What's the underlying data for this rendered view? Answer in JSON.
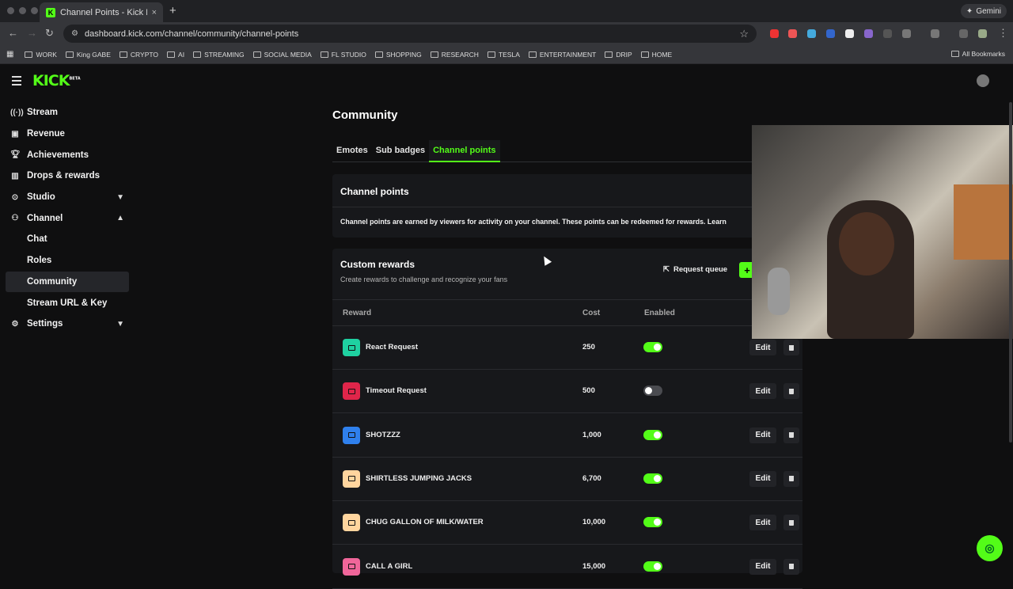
{
  "browser": {
    "tab_title": "Channel Points - Kick Dashbo",
    "tab_close": "×",
    "new_tab": "+",
    "url": "dashboard.kick.com/channel/community/channel-points",
    "gemini_label": "Gemini",
    "bookmarks": [
      "WORK",
      "King GABE",
      "CRYPTO",
      "AI",
      "STREAMING",
      "SOCIAL MEDIA",
      "FL STUDIO",
      "SHOPPING",
      "RESEARCH",
      "TESLA",
      "ENTERTAINMENT",
      "DRIP",
      "HOME"
    ],
    "all_bookmarks": "All Bookmarks"
  },
  "brand": {
    "logo": "KICK",
    "badge": "BETA",
    "accent": "#53fc18"
  },
  "sidebar": {
    "items": [
      {
        "label": "Stream",
        "icon": "broadcast-icon"
      },
      {
        "label": "Revenue",
        "icon": "wallet-icon"
      },
      {
        "label": "Achievements",
        "icon": "trophy-icon"
      },
      {
        "label": "Drops & rewards",
        "icon": "gift-icon"
      },
      {
        "label": "Studio",
        "icon": "studio-icon"
      },
      {
        "label": "Channel",
        "icon": "users-icon"
      },
      {
        "label": "Chat"
      },
      {
        "label": "Roles"
      },
      {
        "label": "Community"
      },
      {
        "label": "Stream URL & Key"
      },
      {
        "label": "Settings",
        "icon": "gear-icon"
      }
    ]
  },
  "main": {
    "title": "Community",
    "tabs": [
      "Emotes",
      "Sub badges",
      "Channel points"
    ],
    "channel_points": {
      "heading": "Channel points",
      "description": "Channel points are earned by viewers for activity on your channel. These points can be redeemed for rewards. Learn"
    },
    "custom_rewards": {
      "heading": "Custom rewards",
      "subtitle": "Create rewards to challenge and recognize your fans",
      "request_queue": "Request queue",
      "add": "+",
      "columns": {
        "reward": "Reward",
        "cost": "Cost",
        "enabled": "Enabled"
      },
      "edit_label": "Edit",
      "rows": [
        {
          "name": "React Request",
          "cost": "250",
          "enabled": true,
          "color": "#1fd1a1"
        },
        {
          "name": "Timeout Request",
          "cost": "500",
          "enabled": false,
          "color": "#e0254a"
        },
        {
          "name": "SHOTZZZ",
          "cost": "1,000",
          "enabled": true,
          "color": "#2f80ed"
        },
        {
          "name": "SHIRTLESS JUMPING JACKS",
          "cost": "6,700",
          "enabled": true,
          "color": "#ffd59e"
        },
        {
          "name": "CHUG GALLON OF MILK/WATER",
          "cost": "10,000",
          "enabled": true,
          "color": "#ffd59e"
        },
        {
          "name": "CALL A GIRL",
          "cost": "15,000",
          "enabled": true,
          "color": "#f0669a"
        }
      ]
    }
  }
}
